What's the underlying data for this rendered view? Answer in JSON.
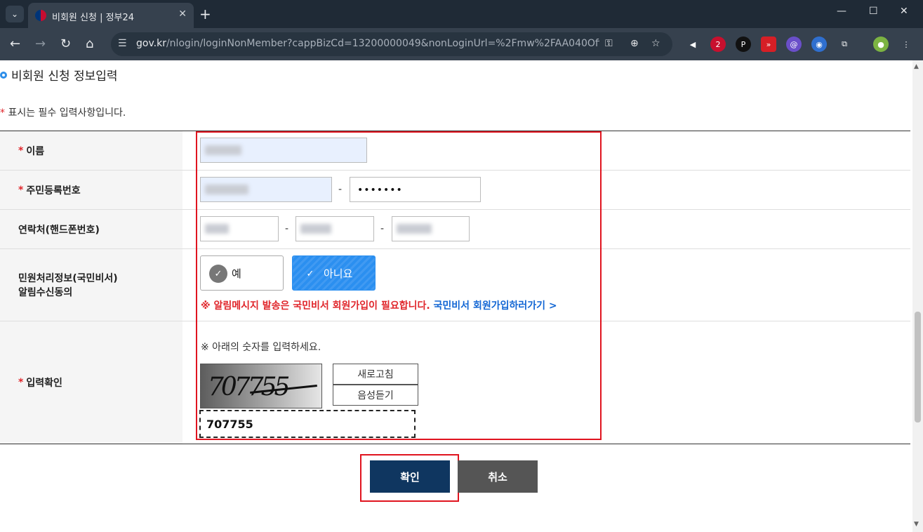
{
  "browser": {
    "tab_title": "비회원 신청 | 정부24",
    "url_domain": "gov.kr",
    "url_path": "/nlogin/loginNonMember?cappBizCd=13200000049&nonLoginUrl=%2Fmw%2FAA040OfferMain...",
    "extension_badge": "2"
  },
  "page": {
    "section_title": "비회원 신청 정보입력",
    "required_notice": "표시는 필수 입력사항입니다.",
    "required_mark": "*"
  },
  "form": {
    "name_label": "이름",
    "rrn_label": "주민등록번호",
    "rrn_back": "•••••••",
    "phone_label": "연락처(핸드폰번호)",
    "dash": "-",
    "consent_label_1": "민원처리정보(국민비서)",
    "consent_label_2": "알림수신동의",
    "consent_yes": "예",
    "consent_no": "아니요",
    "alert_text": "※ 알림메시지 발송은 국민비서 회원가입이 필요합니다.",
    "alert_link": "국민비서 회원가입하러가기 >",
    "captcha_label": "입력확인",
    "captcha_note": "※ 아래의 숫자를 입력하세요.",
    "captcha_digits": "707755",
    "refresh_label": "새로고침",
    "audio_label": "음성듣기",
    "captcha_value": "707755"
  },
  "actions": {
    "confirm_label": "확인",
    "cancel_label": "취소"
  },
  "colors": {
    "accent_blue": "#2b8ff0",
    "required_red": "#e0262b",
    "link_blue": "#1266d4",
    "confirm_navy": "#0f3660",
    "highlight_red": "#e0141f"
  }
}
